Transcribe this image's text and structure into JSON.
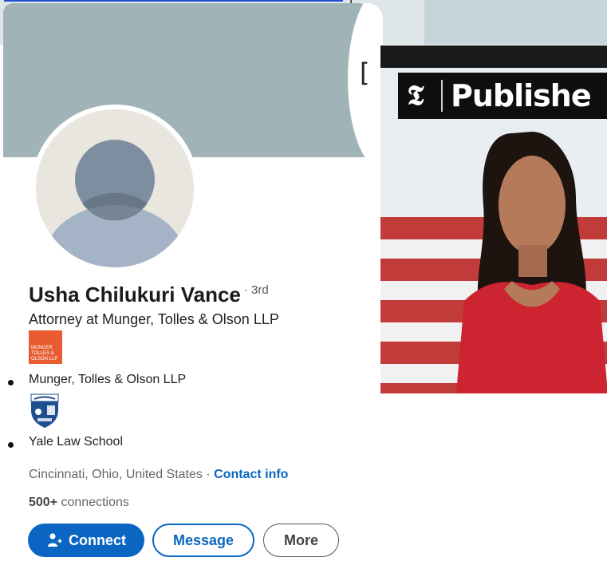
{
  "profile": {
    "name": "Usha Chilukuri Vance",
    "degree": "· 3rd",
    "headline": "Attorney at Munger, Tolles & Olson LLP",
    "experience": [
      {
        "org": "Munger, Tolles & Olson LLP",
        "logo_text": "MUNGER TOLLES & OLSON LLP"
      },
      {
        "org": "Yale Law School"
      }
    ],
    "location": "Cincinnati, Ohio, United States ·",
    "contact_label": "Contact info",
    "connections_count": "500+",
    "connections_label": " connections"
  },
  "actions": {
    "connect": "Connect",
    "message": "Message",
    "more": "More"
  },
  "article_image": {
    "banner_text": "Publishe",
    "logo_glyph": "𝕿"
  },
  "decor": {
    "bracket_left": "[",
    "bracket_top": "]"
  },
  "colors": {
    "primary": "#0a66c2",
    "cover": "#a0b4b7",
    "mto_logo": "#e95b31"
  }
}
